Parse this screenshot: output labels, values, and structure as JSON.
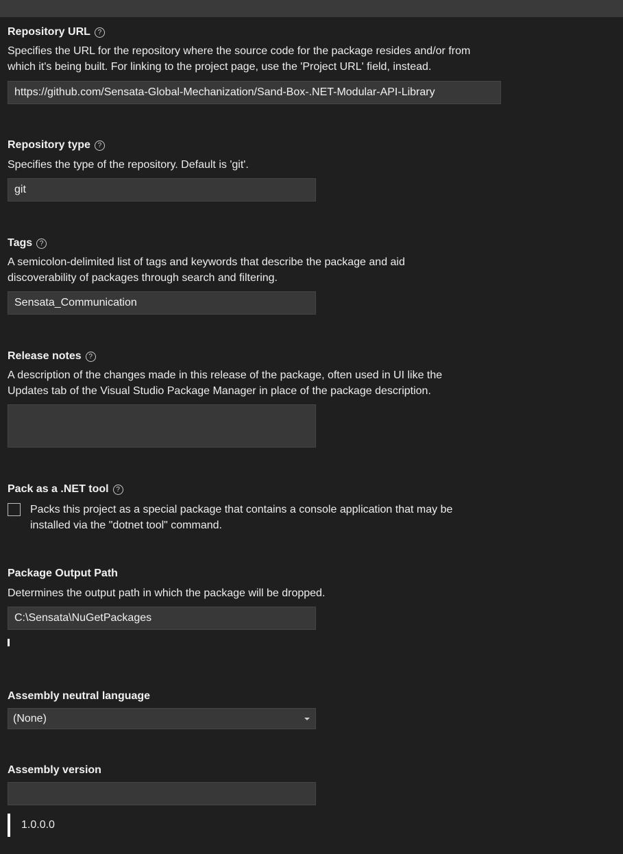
{
  "repository_url": {
    "label": "Repository URL",
    "help_icon": "?",
    "description_line1": "Specifies the URL for the repository where the source code for the package resides and/or from",
    "description_line2": "which it's being built. For linking to the project page, use the 'Project URL' field, instead.",
    "value": "https://github.com/Sensata-Global-Mechanization/Sand-Box-.NET-Modular-API-Library"
  },
  "repository_type": {
    "label": "Repository type",
    "help_icon": "?",
    "description": "Specifies the type of the repository. Default is 'git'.",
    "value": "git"
  },
  "tags": {
    "label": "Tags",
    "help_icon": "?",
    "description_line1": "A semicolon-delimited list of tags and keywords that describe the package and aid",
    "description_line2": "discoverability of packages through search and filtering.",
    "value": "Sensata_Communication"
  },
  "release_notes": {
    "label": "Release notes",
    "help_icon": "?",
    "description_line1": "A description of the changes made in this release of the package, often used in UI like the",
    "description_line2": "Updates tab of the Visual Studio Package Manager in place of the package description.",
    "value": ""
  },
  "pack_as_tool": {
    "label": "Pack as a .NET tool",
    "help_icon": "?",
    "checkbox_line1": "Packs this project as a special package that contains a console application that may be",
    "checkbox_line2": "installed via the \"dotnet tool\" command.",
    "checked": false
  },
  "package_output_path": {
    "label": "Package Output Path",
    "description": "Determines the output path in which the package will be dropped.",
    "value": "C:\\Sensata\\NuGetPackages"
  },
  "assembly_neutral_language": {
    "label": "Assembly neutral language",
    "selected": "(None)"
  },
  "assembly_version": {
    "label": "Assembly version",
    "value": "",
    "evaluated_value": "1.0.0.0"
  },
  "colors": {
    "background": "#1f1f1f",
    "field_background": "#383838",
    "text": "#f1f1f1"
  }
}
